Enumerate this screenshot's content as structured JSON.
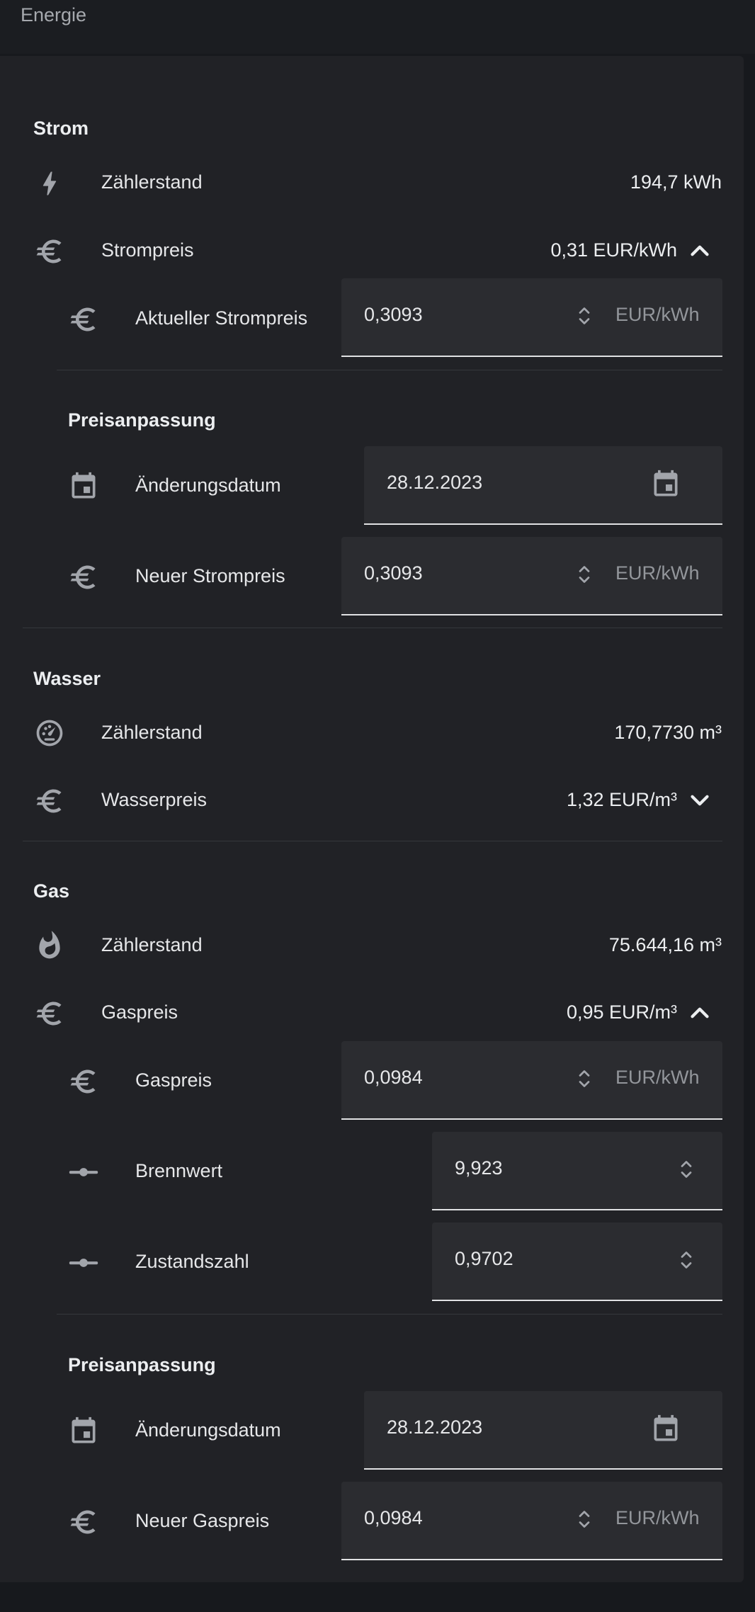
{
  "app": {
    "title": "Energie"
  },
  "strom": {
    "title": "Strom",
    "meter": {
      "label": "Zählerstand",
      "value": "194,7 kWh",
      "icon": "lightning-icon"
    },
    "price": {
      "label": "Strompreis",
      "value": "0,31 EUR/kWh",
      "expanded": true,
      "icon": "euro-icon"
    },
    "current_price": {
      "label": "Aktueller Strompreis",
      "value": "0,3093",
      "unit": "EUR/kWh"
    },
    "adjustment": {
      "title": "Preisanpassung",
      "date": {
        "label": "Änderungsdatum",
        "value": "28.12.2023"
      },
      "new_price": {
        "label": "Neuer Strompreis",
        "value": "0,3093",
        "unit": "EUR/kWh"
      }
    }
  },
  "wasser": {
    "title": "Wasser",
    "meter": {
      "label": "Zählerstand",
      "value": "170,7730 m³",
      "icon": "gauge-icon"
    },
    "price": {
      "label": "Wasserpreis",
      "value": "1,32 EUR/m³",
      "expanded": false,
      "icon": "euro-icon"
    }
  },
  "gas": {
    "title": "Gas",
    "meter": {
      "label": "Zählerstand",
      "value": "75.644,16 m³",
      "icon": "flame-icon"
    },
    "price": {
      "label": "Gaspreis",
      "value": "0,95 EUR/m³",
      "expanded": true,
      "icon": "euro-icon"
    },
    "gas_price": {
      "label": "Gaspreis",
      "value": "0,0984",
      "unit": "EUR/kWh"
    },
    "calorific": {
      "label": "Brennwert",
      "value": "9,923"
    },
    "state_number": {
      "label": "Zustandszahl",
      "value": "0,9702"
    },
    "adjustment": {
      "title": "Preisanpassung",
      "date": {
        "label": "Änderungsdatum",
        "value": "28.12.2023"
      },
      "new_price": {
        "label": "Neuer Gaspreis",
        "value": "0,0984",
        "unit": "EUR/kWh"
      }
    }
  },
  "colors": {
    "background": "#17191d",
    "card": "#212226",
    "field": "#2b2c30",
    "icon": "#a2a5ab"
  }
}
